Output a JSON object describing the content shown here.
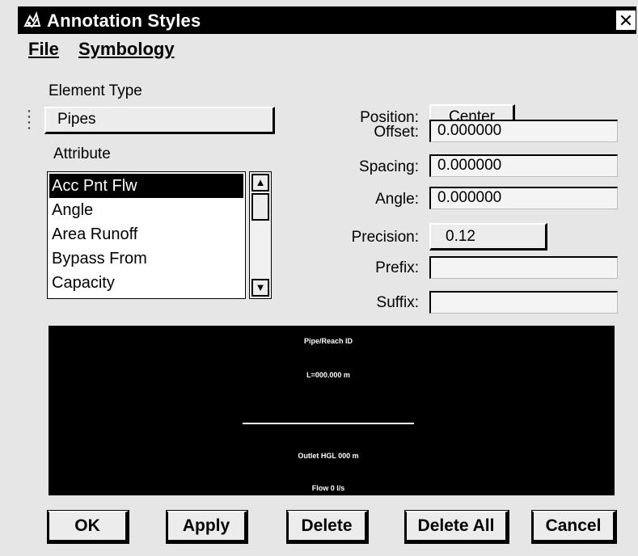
{
  "window": {
    "title": "Annotation Styles",
    "close_symbol": "✕"
  },
  "menu": {
    "file": "File",
    "symbology": "Symbology"
  },
  "element_type": {
    "label": "Element Type",
    "value": "Pipes"
  },
  "attribute": {
    "label": "Attribute",
    "items": [
      "Acc Pnt Flw",
      "Angle",
      "Area Runoff",
      "Bypass From",
      "Capacity"
    ],
    "selected_index": 0
  },
  "position": {
    "label": "Position:",
    "value": "Center"
  },
  "offset": {
    "label": "Offset:",
    "value": "0.000000"
  },
  "spacing": {
    "label": "Spacing:",
    "value": "0.000000"
  },
  "angle": {
    "label": "Angle:",
    "value": "0.000000"
  },
  "precision": {
    "label": "Precision:",
    "value": "0.12"
  },
  "prefix": {
    "label": "Prefix:",
    "value": ""
  },
  "suffix": {
    "label": "Suffix:",
    "value": ""
  },
  "preview": {
    "line1": "Pipe/Reach ID",
    "line2": "L=000.000 m",
    "line3": "Outlet HGL 000 m",
    "line4": "Flow 0 l/s"
  },
  "buttons": {
    "ok": "OK",
    "apply": "Apply",
    "delete": "Delete",
    "delete_all": "Delete All",
    "cancel": "Cancel"
  },
  "colors": {
    "titlebar": "#000000",
    "selection": "#000000",
    "preview_bg": "#000000"
  }
}
